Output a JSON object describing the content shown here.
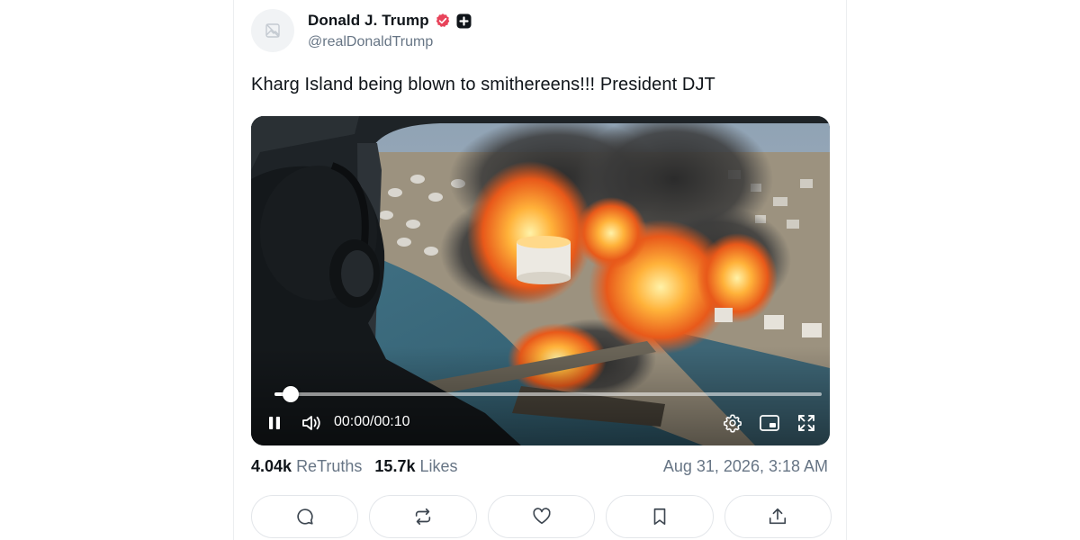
{
  "post": {
    "author": {
      "display_name": "Donald J. Trump",
      "handle": "@realDonaldTrump",
      "verified": true
    },
    "text": "Kharg Island being blown to smithereens!!! President DJT",
    "media": {
      "type": "video",
      "current_time": "00:00",
      "separator": "/",
      "duration": "00:10",
      "progress": 0.03
    },
    "stats": {
      "retruths_count": "4.04k",
      "retruths_label": "ReTruths",
      "likes_count": "15.7k",
      "likes_label": "Likes"
    },
    "timestamp": "Aug 31, 2026, 3:18 AM"
  },
  "actions": [
    {
      "icon": "reply-icon"
    },
    {
      "icon": "retruth-icon"
    },
    {
      "icon": "like-icon"
    },
    {
      "icon": "bookmark-icon"
    },
    {
      "icon": "share-icon"
    }
  ],
  "colors": {
    "verified_badge": "#e8435a",
    "muted_text": "#677585",
    "primary_text": "#0f1419"
  }
}
